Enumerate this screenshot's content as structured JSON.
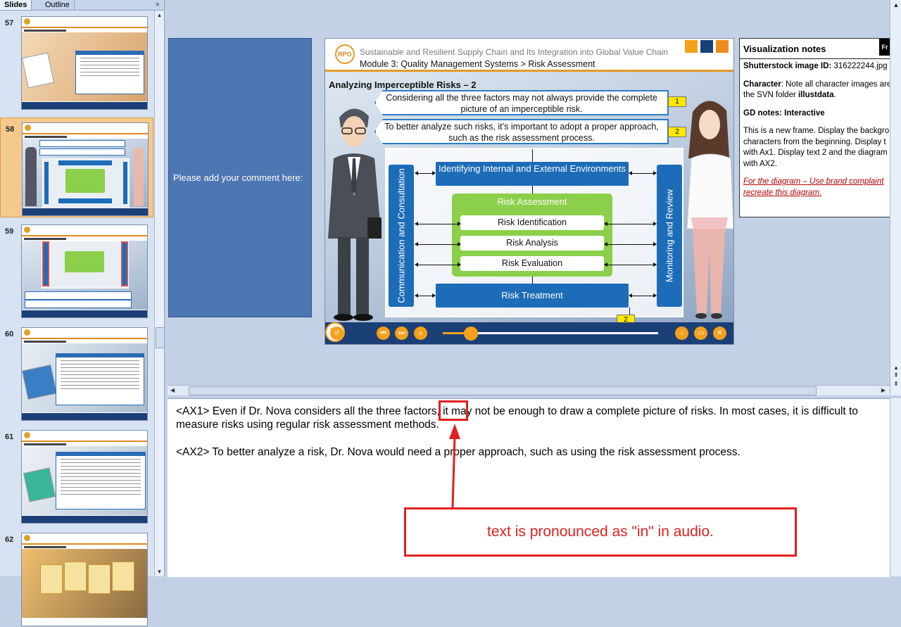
{
  "panes": {
    "tabs": [
      {
        "label": "Slides"
      },
      {
        "label": "Outline"
      }
    ],
    "close_glyph": "×"
  },
  "thumbnails": [
    {
      "number": "57",
      "selected": false
    },
    {
      "number": "58",
      "selected": true
    },
    {
      "number": "59",
      "selected": false
    },
    {
      "number": "60",
      "selected": false
    },
    {
      "number": "61",
      "selected": false
    },
    {
      "number": "62",
      "selected": false
    }
  ],
  "comment_box": {
    "text": "Please add your comment here:"
  },
  "slide": {
    "course_title": "Sustainable and Resilient Supply Chain and Its Integration into Global Value Chain",
    "module": "Module 3: Quality Management Systems > Risk Assessment",
    "logo_text": "RPO",
    "title": "Analyzing Imperceptible Risks – 2",
    "callouts": [
      {
        "text": "Considering all the three factors may not always provide the complete picture of an imperceptible risk.",
        "tag": "1"
      },
      {
        "text": "To better analyze such risks, it’s important to adopt a proper approach, such as the risk assessment process.",
        "tag": "2"
      }
    ],
    "diagram": {
      "left_label": "Communication and Consultation",
      "right_label": "Monitoring and Review",
      "top_box": "Identifying Internal and External Environments",
      "assessment_title": "Risk Assessment",
      "assessment_items": [
        "Risk Identification",
        "Risk Analysis",
        "Risk Evaluation"
      ],
      "bottom_box": "Risk Treatment",
      "bottom_tag": "2"
    },
    "player": {
      "progress": 0.13,
      "controls": [
        "replay-icon",
        "play-icon",
        "previous-icon",
        "next-icon",
        "fast-forward-icon",
        "volume-icon",
        "caption-icon",
        "close-icon"
      ]
    },
    "colors": {
      "accent": "#e59a26",
      "blue": "#1d6cb8",
      "green": "#8ccf4a",
      "navy": "#1b3f77"
    }
  },
  "viz_notes": {
    "title": "Visualization notes",
    "fr_tag": "Fr",
    "image_label": "Shutterstock image ID:",
    "image_id": "316222244.jpg",
    "character_label": "Character",
    "character_text": ": Note all character images are",
    "character_text2": "the SVN folder ",
    "character_folder": "illustdata",
    "gd_label": "GD notes: Interactive",
    "frame_lines": [
      "This is a new frame. Display the backgro",
      "characters from the beginning. Display t",
      "with Ax1. Display text 2 and the diagram",
      "with AX2."
    ],
    "red_lines": [
      "For the diagram – Use brand complaint",
      "recreate this diagram."
    ]
  },
  "notes": {
    "ax1": "<AX1> Even if Dr. Nova considers all the three factors, it may not be enough to draw a complete picture of risks. In most cases, it is difficult to measure  risks using regular risk assessment  methods.",
    "ax2": "<AX2> To better analyze a risk, Dr. Nova would need a proper approach, such as using the risk assessment process."
  },
  "annotation": {
    "text": "text is pronounced as \"in\" in audio."
  }
}
